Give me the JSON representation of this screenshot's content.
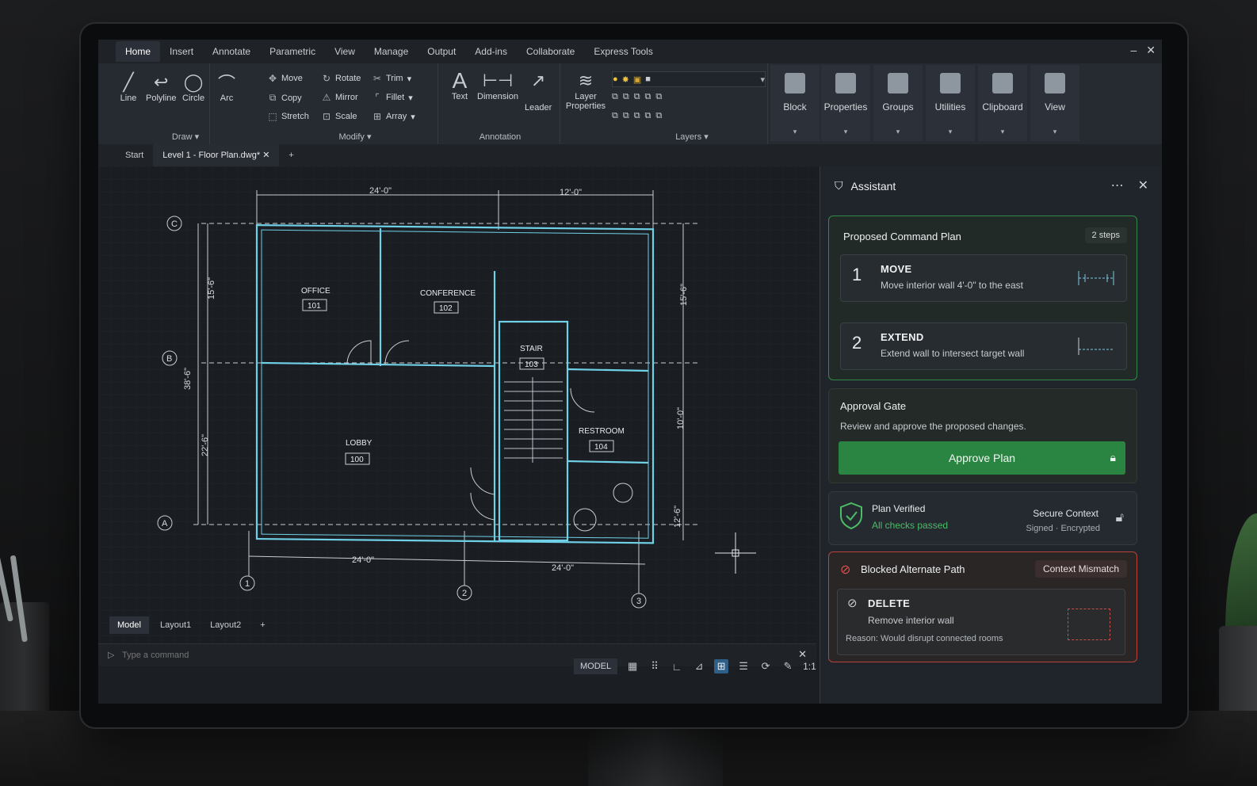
{
  "menu": {
    "tabs": [
      "Home",
      "Insert",
      "Annotate",
      "Parametric",
      "View",
      "Manage",
      "Output",
      "Add-ins",
      "Collaborate",
      "Express Tools"
    ],
    "active": "Home"
  },
  "ribbon": {
    "draw": {
      "title": "Draw",
      "tools": [
        "Line",
        "Polyline",
        "Circle",
        "Arc"
      ]
    },
    "modify": {
      "title": "Modify",
      "tools": [
        "Move",
        "Rotate",
        "Trim",
        "Copy",
        "Mirror",
        "Fillet",
        "Stretch",
        "Scale",
        "Array"
      ]
    },
    "annotation": {
      "title": "Annotation",
      "tools": [
        "Text",
        "Dimension",
        "Leader"
      ]
    },
    "layers": {
      "title": "Layers",
      "tool": "Layer Properties"
    },
    "big_buttons": [
      "Block",
      "Properties",
      "Groups",
      "Utilities",
      "Clipboard",
      "View"
    ]
  },
  "doc_tabs": {
    "start": "Start",
    "active": "Level 1 - Floor Plan.dwg*",
    "add": "+"
  },
  "drawing": {
    "dims_top": [
      "24'-0\"",
      "12'-0\""
    ],
    "dims_bottom": [
      "24'-0\"",
      "24'-0\""
    ],
    "dims_left": [
      "15'-6\"",
      "38'-6\"",
      "22'-6\""
    ],
    "dims_right": [
      "15'-6\"",
      "10'-0\"",
      "12'-6\""
    ],
    "grid_rows": [
      "C",
      "B",
      "A"
    ],
    "grid_cols": [
      "1",
      "2",
      "3"
    ],
    "rooms": [
      {
        "name": "OFFICE",
        "num": "101"
      },
      {
        "name": "CONFERENCE",
        "num": "102"
      },
      {
        "name": "STAIR",
        "num": "103"
      },
      {
        "name": "RESTROOM",
        "num": "104"
      },
      {
        "name": "LOBBY",
        "num": "100"
      }
    ]
  },
  "layout_tabs": [
    "Model",
    "Layout1",
    "Layout2",
    "+"
  ],
  "command": {
    "placeholder": "Type a command"
  },
  "status": {
    "model": "MODEL",
    "scale": "1:1"
  },
  "assistant": {
    "title": "Assistant",
    "plan": {
      "title": "Proposed Command Plan",
      "badge": "2 steps",
      "steps": [
        {
          "num": "1",
          "name": "MOVE",
          "desc": "Move interior wall 4'-0\" to the east"
        },
        {
          "num": "2",
          "name": "EXTEND",
          "desc": "Extend wall to intersect target wall"
        }
      ]
    },
    "gate": {
      "title": "Approval Gate",
      "desc": "Review and approve the proposed changes.",
      "button": "Approve Plan"
    },
    "verified": {
      "title": "Plan Verified",
      "sub": "All checks passed",
      "right_title": "Secure Context",
      "right_sub": "Signed · Encrypted"
    },
    "blocked": {
      "title": "Blocked Alternate Path",
      "badge": "Context Mismatch",
      "name": "DELETE",
      "desc": "Remove interior wall",
      "reason": "Reason: Would disrupt connected rooms"
    }
  },
  "colors": {
    "accent_green": "#2a8543",
    "blocked_red": "#b8433c",
    "wall_cyan": "#6fd0e6"
  }
}
